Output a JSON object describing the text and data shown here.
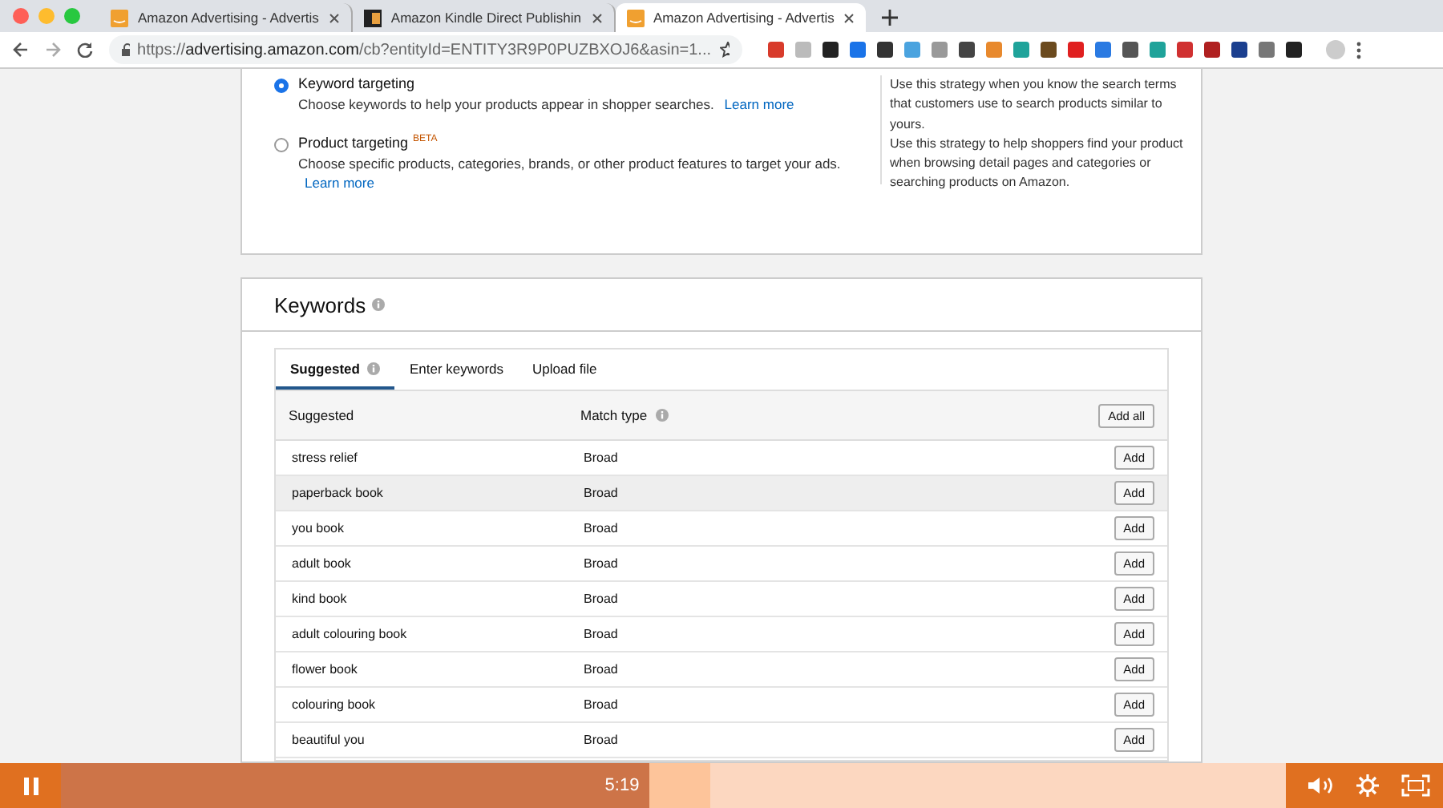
{
  "browser_tabs": [
    {
      "title": "Amazon Advertising - Advertis",
      "kind": "amazon",
      "selected": false
    },
    {
      "title": "Amazon Kindle Direct Publishin",
      "kind": "kdp",
      "selected": false
    },
    {
      "title": "Amazon Advertising - Advertis",
      "kind": "amazon",
      "selected": true
    }
  ],
  "address_bar": {
    "scheme": "https://",
    "host": "advertising.amazon.com",
    "path": "/cb?entityId=ENTITY3R9P0PUZBXOJ6&asin=1..."
  },
  "targeting": {
    "options": [
      {
        "label": "Keyword targeting",
        "description": "Choose keywords to help your products appear in shopper searches.",
        "link": "Learn more",
        "selected": true
      },
      {
        "label": "Product targeting",
        "badge": "BETA",
        "description": "Choose specific products, categories, brands, or other product features to target your ads.",
        "link": "Learn more",
        "selected": false
      }
    ],
    "help": [
      "Use this strategy when you know the search terms that customers use to search products similar to yours.",
      "Use this strategy to help shoppers find your product when browsing detail pages and categories or searching products on Amazon."
    ]
  },
  "keywords": {
    "title": "Keywords",
    "tabs": [
      {
        "label": "Suggested",
        "info": true,
        "selected": true
      },
      {
        "label": "Enter keywords",
        "info": false,
        "selected": false
      },
      {
        "label": "Upload file",
        "info": false,
        "selected": false
      }
    ],
    "columns": [
      "Suggested",
      "Match type"
    ],
    "add_all": "Add all",
    "rows": [
      {
        "keyword": "stress relief",
        "match": "Broad",
        "action": "Add",
        "hovered": false
      },
      {
        "keyword": "paperback book",
        "match": "Broad",
        "action": "Add",
        "hovered": true
      },
      {
        "keyword": "you book",
        "match": "Broad",
        "action": "Add",
        "hovered": false
      },
      {
        "keyword": "adult book",
        "match": "Broad",
        "action": "Add",
        "hovered": false
      },
      {
        "keyword": "kind book",
        "match": "Broad",
        "action": "Add",
        "hovered": false
      },
      {
        "keyword": "adult colouring book",
        "match": "Broad",
        "action": "Add",
        "hovered": false
      },
      {
        "keyword": "flower book",
        "match": "Broad",
        "action": "Add",
        "hovered": false
      },
      {
        "keyword": "colouring book",
        "match": "Broad",
        "action": "Add",
        "hovered": false
      },
      {
        "keyword": "beautiful you",
        "match": "Broad",
        "action": "Add",
        "hovered": false
      }
    ]
  },
  "player": {
    "time": "5:19",
    "level": 0.48,
    "playing": true
  }
}
